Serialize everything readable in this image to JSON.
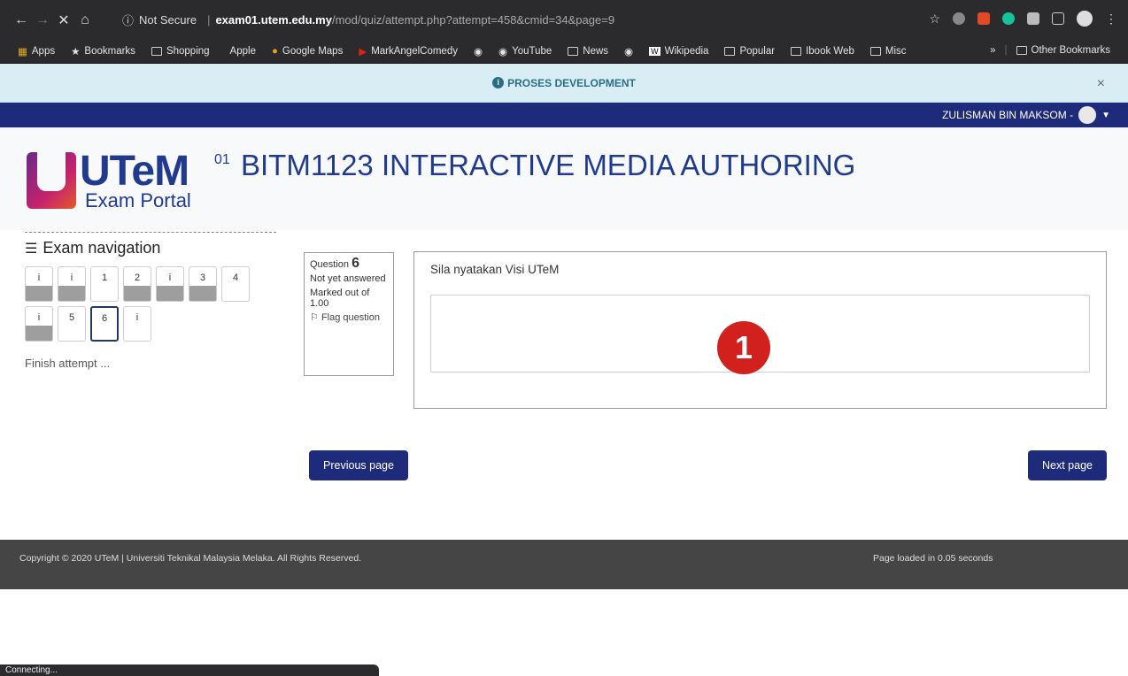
{
  "browser": {
    "not_secure": "Not Secure",
    "url_host": "exam01.utem.edu.my",
    "url_path": "/mod/quiz/attempt.php?attempt=458&cmid=34&page=9",
    "bookmarks": [
      "Apps",
      "Bookmarks",
      "Shopping",
      "Apple",
      "Google Maps",
      "MarkAngelComedy",
      "YouTube",
      "News",
      "Wikipedia",
      "Popular",
      "Ibook Web",
      "Misc"
    ],
    "overflow": "»",
    "other_bookmarks": "Other Bookmarks",
    "status": "Connecting..."
  },
  "notice": {
    "text": "PROSES DEVELOPMENT",
    "close": "×"
  },
  "user": {
    "name": "ZULISMAN BIN MAKSOM -"
  },
  "logo": {
    "brand": "UTeM",
    "sub": "Exam Portal",
    "sup": "01"
  },
  "course": {
    "title": "BITM1123 INTERACTIVE MEDIA AUTHORING"
  },
  "nav": {
    "heading": "Exam navigation",
    "buttons": [
      {
        "label": "i",
        "state": "grey"
      },
      {
        "label": "i",
        "state": "grey"
      },
      {
        "label": "1",
        "state": "empty"
      },
      {
        "label": "2",
        "state": "grey"
      },
      {
        "label": "i",
        "state": "grey"
      },
      {
        "label": "3",
        "state": "grey"
      },
      {
        "label": "4",
        "state": "empty"
      },
      {
        "label": "i",
        "state": "grey"
      },
      {
        "label": "5",
        "state": "empty"
      },
      {
        "label": "6",
        "state": "current"
      },
      {
        "label": "i",
        "state": "empty"
      }
    ],
    "finish": "Finish attempt ..."
  },
  "question": {
    "label": "Question",
    "number": "6",
    "status": "Not yet answered",
    "marks": "Marked out of 1.00",
    "flag": "Flag question",
    "text": "Sila nyatakan Visi UTeM",
    "marker": "1"
  },
  "buttons": {
    "prev": "Previous page",
    "next": "Next page"
  },
  "footer": {
    "copyright": "Copyright © 2020 UTeM | Universiti Teknikal Malaysia Melaka. All Rights Reserved.",
    "loaded": "Page loaded in 0.05 seconds"
  }
}
